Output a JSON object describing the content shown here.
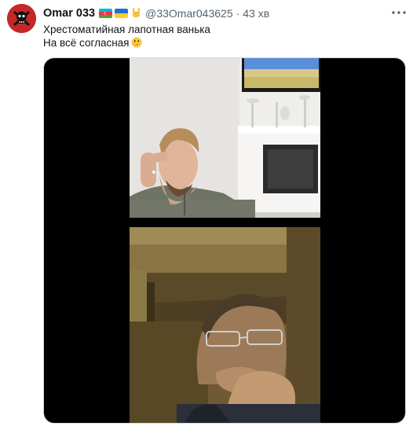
{
  "tweet": {
    "display_name": "Omar 033",
    "badges": [
      "azerbaijan-flag-icon",
      "ukraine-flag-icon",
      "rock-on-hand-icon"
    ],
    "handle": "@33Omar043625",
    "separator": "·",
    "time": "43 хв",
    "text_line1": "Хрестоматийная лапотная ванька",
    "text_line2": "На всё согласная",
    "text_emoji": "grinning-face-icon",
    "media": [
      "video-call-top-frame",
      "video-call-bottom-frame"
    ]
  },
  "colors": {
    "name": "#0f1419",
    "secondary": "#536471",
    "media_bg": "#000000",
    "avatar_bg": "#c62828"
  }
}
